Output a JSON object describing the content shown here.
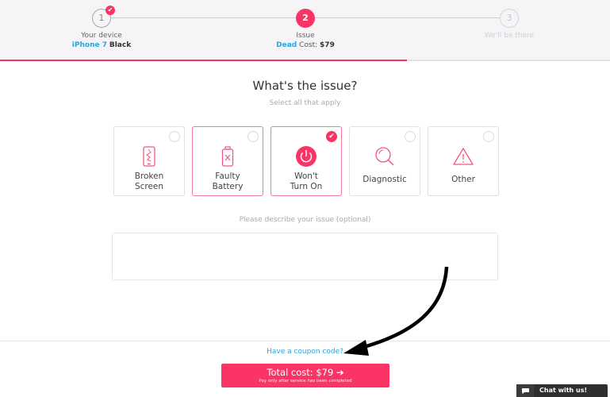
{
  "steps": [
    {
      "number": "1",
      "label": "Your device",
      "detail_highlight": "iPhone 7",
      "detail_rest": "Black",
      "state": "complete",
      "badge": "✔"
    },
    {
      "number": "2",
      "label": "Issue",
      "detail_highlight": "Dead",
      "detail_prefix": "Cost:",
      "detail_value": "$79",
      "state": "active"
    },
    {
      "number": "3",
      "label": "We'll be there",
      "state": "future"
    }
  ],
  "progress_fraction": 0.667,
  "heading": "What's the issue?",
  "subheading": "Select all that apply",
  "issues": [
    {
      "line1": "Broken",
      "line2": "Screen",
      "icon": "broken-phone-icon",
      "selected": false
    },
    {
      "line1": "Faulty",
      "line2": "Battery",
      "icon": "battery-icon",
      "selected": false
    },
    {
      "line1": "Won't",
      "line2": "Turn On",
      "icon": "power-icon",
      "selected": true,
      "check": "✔"
    },
    {
      "line1": "Diagnostic",
      "icon": "magnifier-icon",
      "selected": false
    },
    {
      "line1": "Other",
      "icon": "warning-icon",
      "selected": false
    }
  ],
  "description": {
    "label": "Please describe your issue (optional)",
    "value": "",
    "placeholder": ""
  },
  "coupon_link": "Have a coupon code?",
  "total_button": {
    "label": "Total cost: $79",
    "arrow": "➔",
    "note": "Pay only after service has been completed"
  },
  "chat": {
    "label": "Chat with us!"
  },
  "colors": {
    "accent": "#fb3466",
    "link": "#2aa6db",
    "header_bg": "#f6f4f7"
  }
}
